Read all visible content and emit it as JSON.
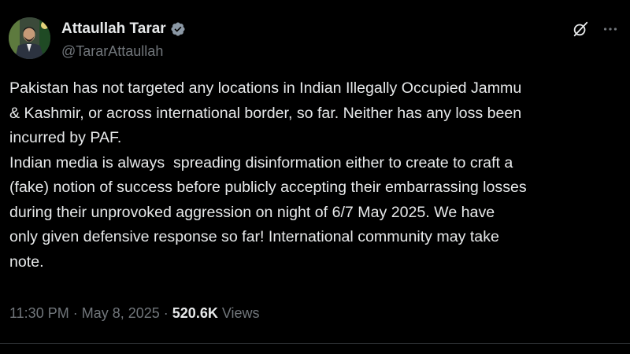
{
  "author": {
    "display_name": "Attaullah Tarar",
    "handle": "@TararAttaullah",
    "verified_icon": "verified-badge-icon",
    "badge_color": "#8b98a5"
  },
  "post": {
    "text": "Pakistan has not targeted any locations in Indian Illegally Occupied Jammu\n& Kashmir, or across international border, so far. Neither has any loss been\nincurred by PAF.\nIndian media is always  spreading disinformation either to create to craft a\n(fake) notion of success before publicly accepting their embarrassing losses\nduring their unprovoked aggression on night of 6/7 May 2025. We have\nonly given defensive response so far! International community may take\nnote."
  },
  "meta": {
    "time": "11:30 PM",
    "separator": " · ",
    "date": "May 8, 2025",
    "views_count": "520.6K",
    "views_label": " Views"
  },
  "actions": {
    "grok_icon": "grok-icon",
    "more_icon": "more-options-icon"
  },
  "colors": {
    "background": "#000000",
    "text_primary": "#e7e9ea",
    "text_secondary": "#71767b"
  }
}
